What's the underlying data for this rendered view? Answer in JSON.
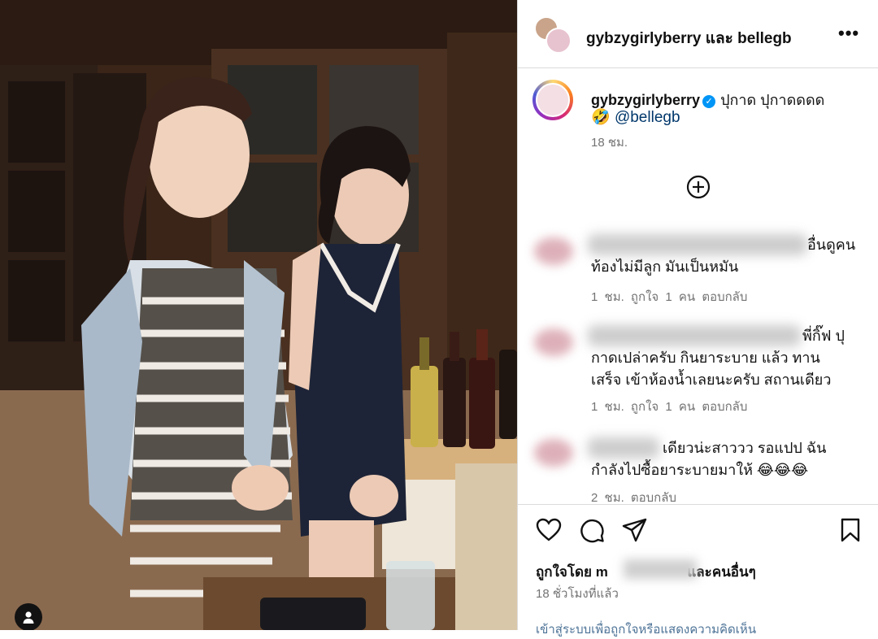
{
  "post": {
    "header_title": "gybzygirlyberry และ bellegb",
    "caption_user": "gybzygirlyberry",
    "caption_text": "ปุกาด ปุกาดดดด",
    "caption_emoji": "🤣",
    "caption_mention": "@bellegb",
    "caption_time": "18 ชม."
  },
  "comments": [
    {
      "text_line1": "อื่นดูคน",
      "text_line2": "ท้องไม่มีลูก มันเป็นหมัน",
      "meta": "1 ชม.  ถูกใจ 1 คน  ตอบกลับ"
    },
    {
      "text_line1": "พี่กิ๊ฟ ปุ",
      "text_line2": "กาดเปล่าครับ กินยาระบาย แล้ว ทาน",
      "text_line3": "เสร็จ เข้าห้องน้ำเลยนะครับ สถานเดียว",
      "meta": "1 ชม.  ถูกใจ 1 คน  ตอบกลับ"
    },
    {
      "text_line1": "เดียวน่ะสาววว รอแปป ฉัน",
      "text_line2": "กำลังไปซื้อยาระบายมาให้ 😂😂😂",
      "meta": "2 ชม.  ตอบกลับ"
    }
  ],
  "footer": {
    "liked_by_prefix": "ถูกใจโดย",
    "liked_by_user": "m",
    "liked_by_suffix": "และคนอื่นๆ",
    "time_ago": "18 ชั่วโมงที่แล้ว",
    "login_prompt": "เข้าสู่ระบบเพื่อถูกใจหรือแสดงความคิดเห็น"
  },
  "icons": {
    "more": "more-icon",
    "add": "add-circle-icon",
    "like": "heart-icon",
    "comment": "comment-icon",
    "share": "share-icon",
    "save": "bookmark-icon",
    "verified": "verified-badge-icon"
  },
  "colors": {
    "link": "#00376b",
    "muted": "#737373",
    "verified": "#0095f6"
  }
}
